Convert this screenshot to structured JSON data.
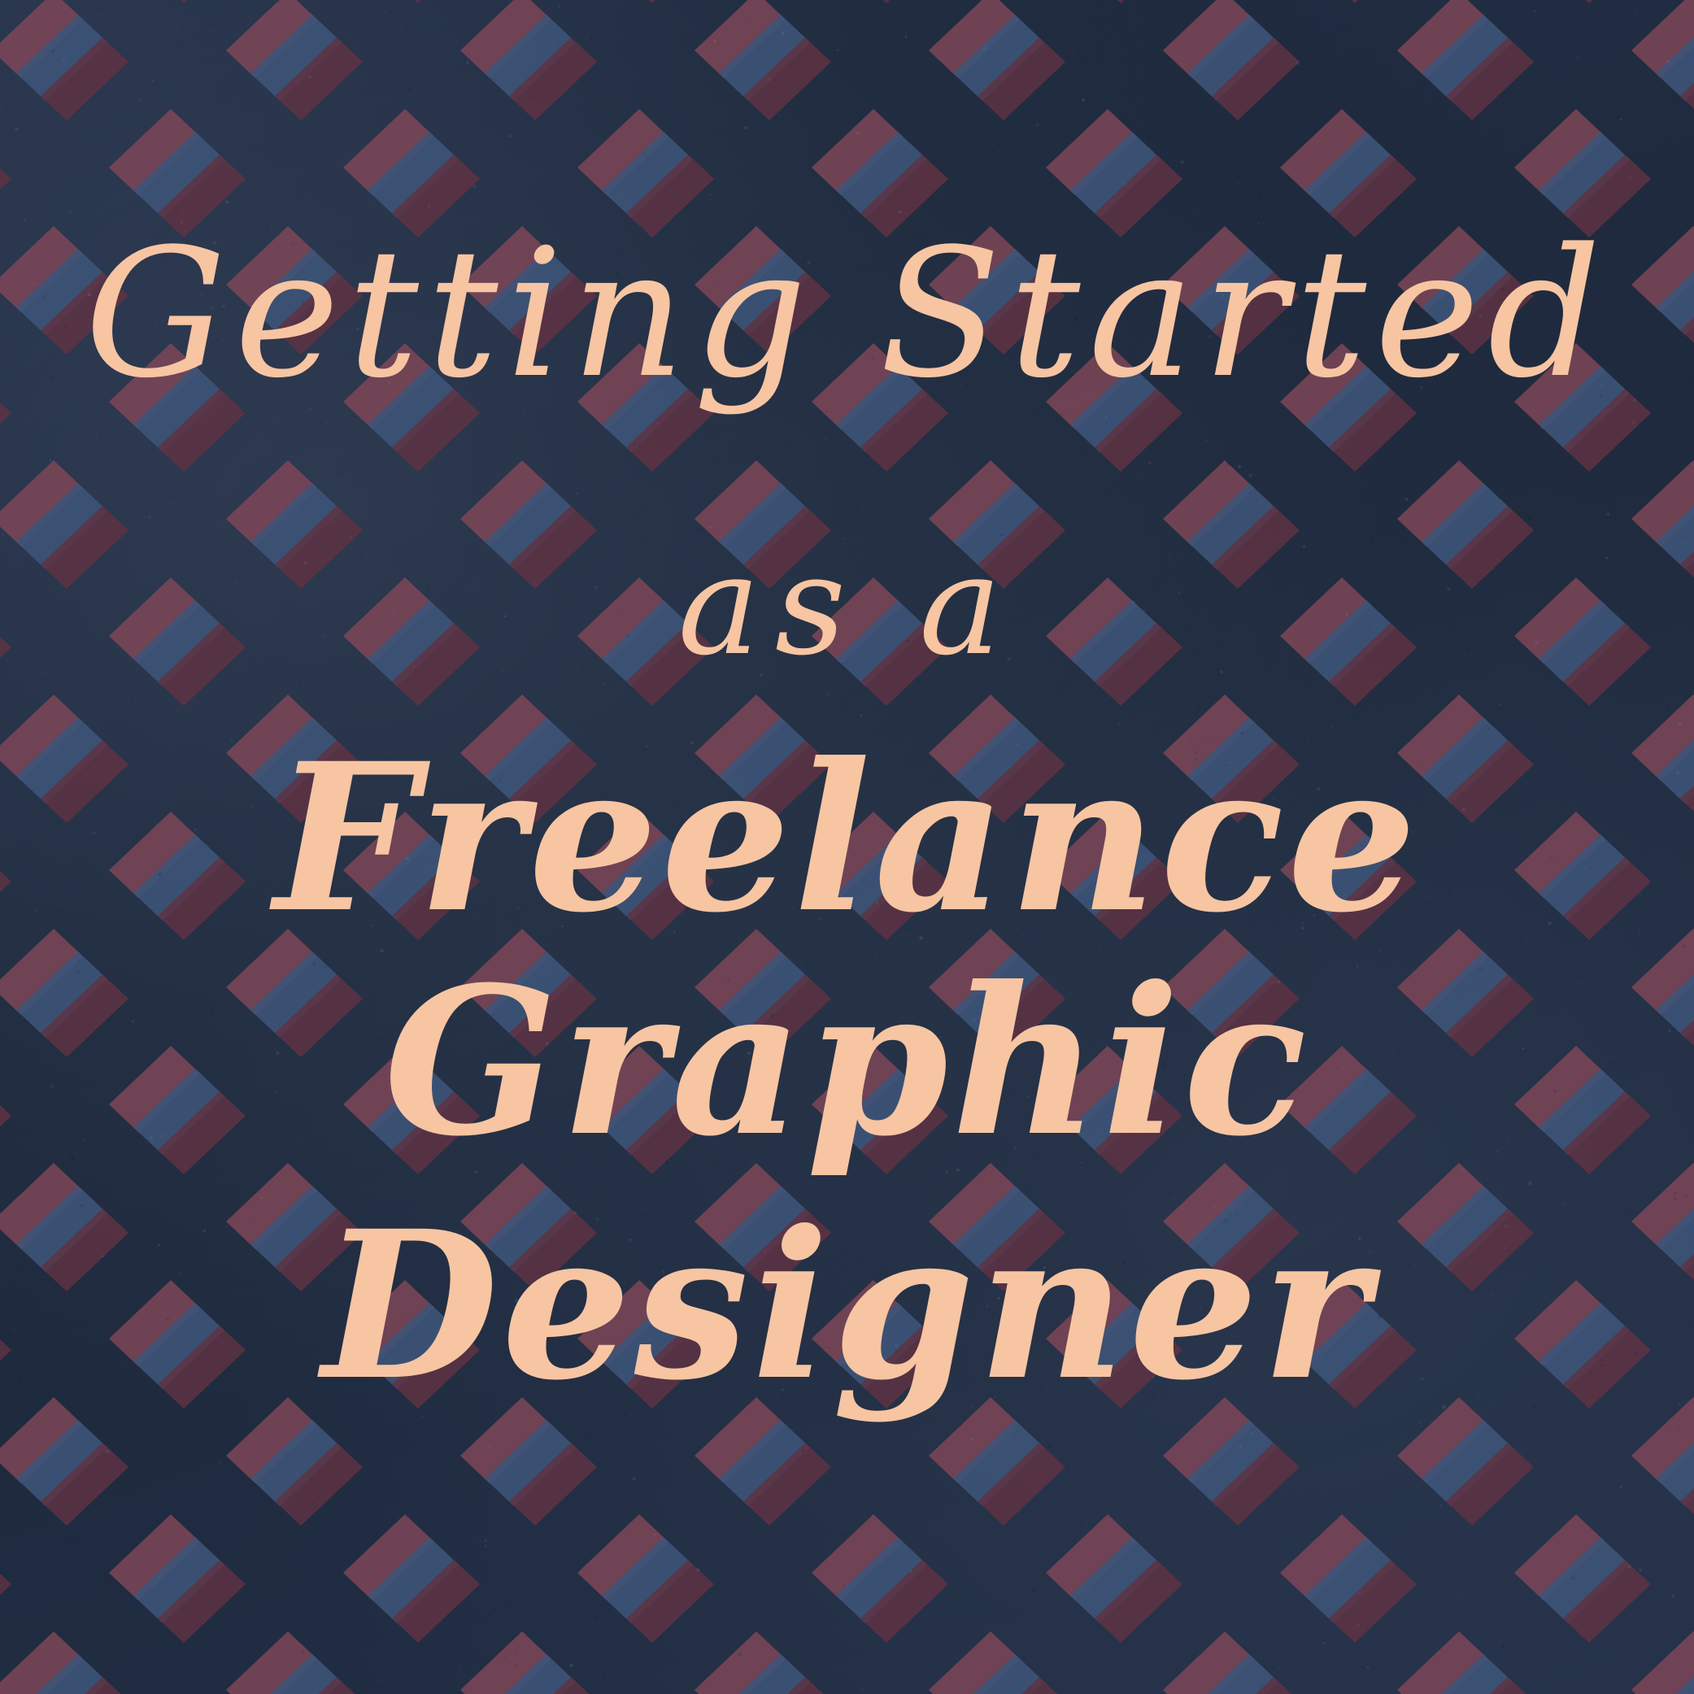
{
  "poster": {
    "title_line_1": "Getting Started",
    "title_line_2": "as a",
    "title_line_3": "Freelance",
    "title_line_4": "Graphic",
    "title_line_5": "Designer"
  },
  "colors": {
    "background": "#1e2a3d",
    "text": "#f7c5a2",
    "stripe_red": "#7c4657",
    "stripe_blue": "#3d5478",
    "stripe_dark_red": "#5e3243"
  },
  "icons": {
    "pattern_motif": "striped-chevron-icon"
  }
}
